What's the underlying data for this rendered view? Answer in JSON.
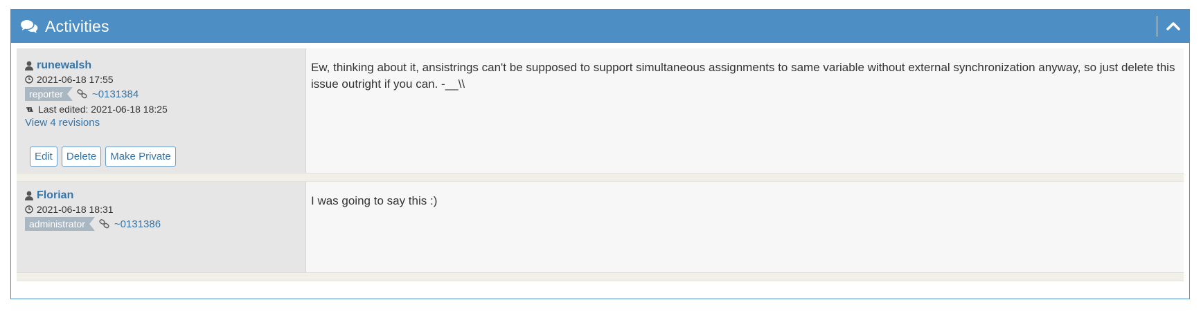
{
  "header": {
    "title": "Activities",
    "icon": "comments-icon",
    "collapse_icon": "chevron-up-icon",
    "color": "#4d8fc4"
  },
  "notes": [
    {
      "author": "runewalsh",
      "timestamp": "2021-06-18 17:55",
      "role": "reporter",
      "note_link": "~0131384",
      "last_edited": "Last edited: 2021-06-18 18:25",
      "revisions": "View 4 revisions",
      "buttons": {
        "edit": "Edit",
        "delete": "Delete",
        "make_private": "Make Private"
      },
      "text": "Ew, thinking about it, ansistrings can't be supposed to support simultaneous assignments to same variable without external synchronization anyway, so just delete this issue outright if you can. -__\\\\"
    },
    {
      "author": "Florian",
      "timestamp": "2021-06-18 18:31",
      "role": "administrator",
      "note_link": "~0131386",
      "text": "I was going to say this :)"
    }
  ]
}
